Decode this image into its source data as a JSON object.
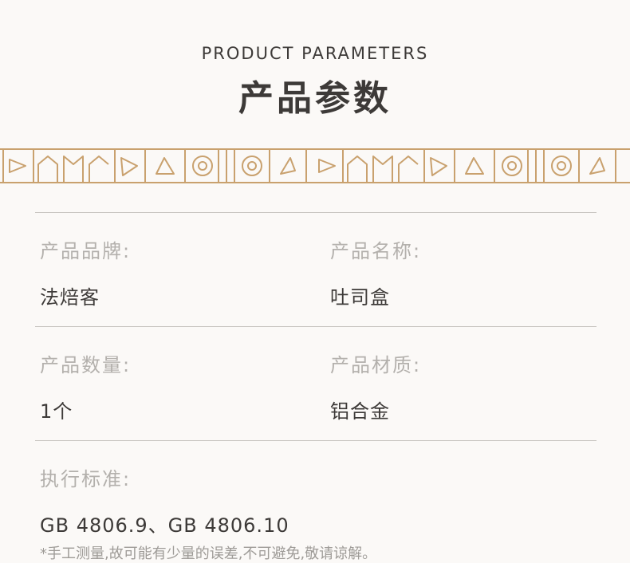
{
  "header": {
    "subtitle_en": "PRODUCT PARAMETERS",
    "title_cn": "产品参数"
  },
  "decoration": {
    "band_color": "#c9a16e",
    "line_color": "#c9a16e"
  },
  "params": [
    {
      "left": {
        "label": "产品品牌:",
        "value": "法焙客"
      },
      "right": {
        "label": "产品名称:",
        "value": "吐司盒"
      }
    },
    {
      "left": {
        "label": "产品数量:",
        "value": "1个"
      },
      "right": {
        "label": "产品材质:",
        "value": "铝合金"
      }
    },
    {
      "left": {
        "label": "执行标准:",
        "value": "GB 4806.9、GB 4806.10"
      }
    }
  ],
  "note": "*手工测量,故可能有少量的误差,不可避免,敬请谅解。"
}
